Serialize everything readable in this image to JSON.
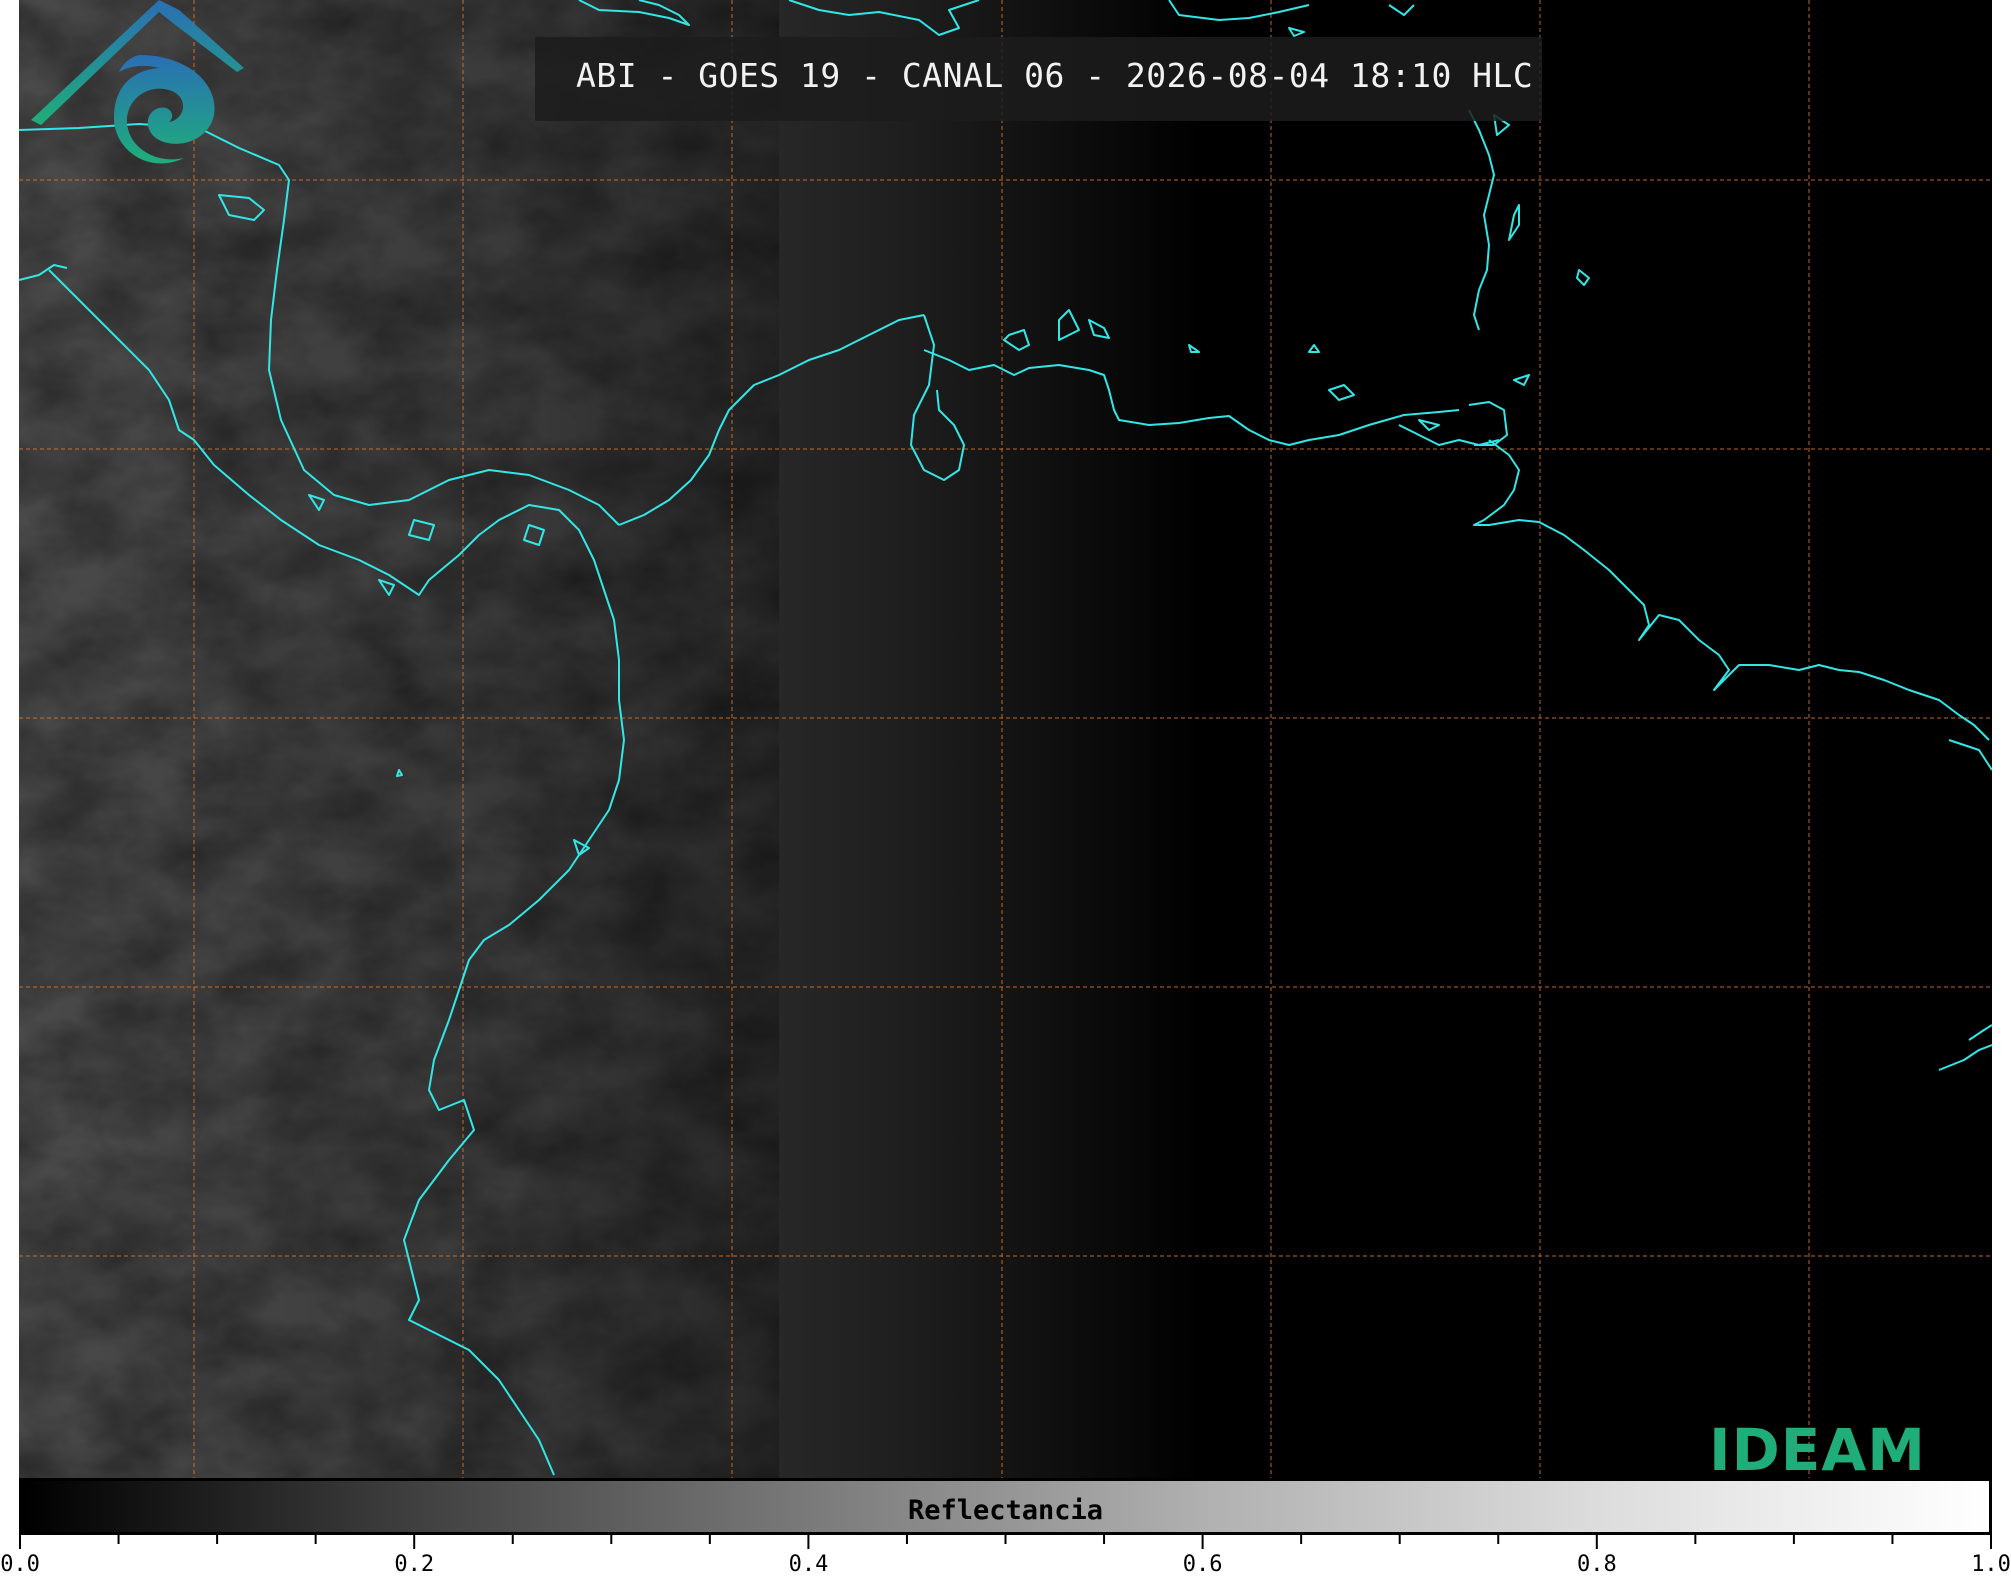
{
  "title": "ABI - GOES 19 - CANAL 06 - 2026-08-04 18:10 HLC",
  "colorbar": {
    "label": "Reflectancia",
    "min": 0.0,
    "max": 1.0,
    "tick_labels": [
      "0.0",
      "0.2",
      "0.4",
      "0.6",
      "0.8",
      "1.0"
    ]
  },
  "logo": {
    "text": "IDEAM"
  },
  "colors": {
    "coastline": "#33e6e6",
    "gridlines": "#e07a2a",
    "background": "#000000",
    "logo_green": "#1fae7a",
    "logo_blue": "#2a6fb5"
  }
}
